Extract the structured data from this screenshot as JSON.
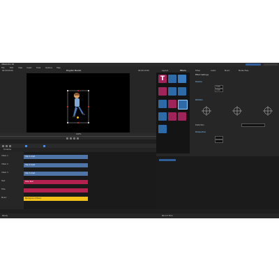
{
  "app": {
    "title": "VEGAS Pro 18",
    "menu": [
      "File",
      "Edit",
      "View",
      "Insert",
      "Tools",
      "Options",
      "Help"
    ],
    "buttons": [
      "Produce",
      "Share"
    ]
  },
  "preview": {
    "title": "Program Monitor",
    "timecode_left": "00:00:00:00",
    "timecode_right": "00:00:10:00",
    "zoom": "100%"
  },
  "effects_tabs": [
    "Layout",
    "Effects",
    "Titles",
    "Audio",
    "Music",
    "Media Files"
  ],
  "properties": {
    "header": "Effect Settings",
    "sections": [
      "Position",
      "Rotation",
      "Perspective"
    ],
    "mode_label": "Distortion",
    "fields": [
      "0.00",
      "0.00",
      "0.00",
      "0.00",
      "0.00",
      "0.00"
    ]
  },
  "timeline": {
    "toolbar_label": "Timeline",
    "track_names": [
      "Video 1",
      "Video 2",
      "Video 3",
      "Text",
      "Title",
      "Music"
    ],
    "clips": [
      "Clip 1.mp4",
      "Clip 2.mp4",
      "Clip 3.mp4",
      "Title Text",
      "Background Music"
    ]
  },
  "status": {
    "left": "Ready",
    "right": "Record time"
  }
}
